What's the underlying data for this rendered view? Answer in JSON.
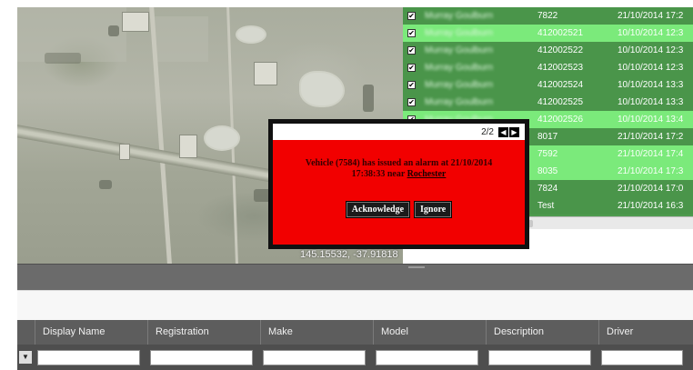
{
  "map": {
    "coordinates": "145.15532, -37.91818"
  },
  "alarm_table": {
    "rows": [
      {
        "name": "Murray Goulburn",
        "vehicle": "7822",
        "timestamp": "21/10/2014 17:2",
        "highlight": false
      },
      {
        "name": "Murray Goulburn",
        "vehicle": "412002521",
        "timestamp": "10/10/2014 12:3",
        "highlight": true
      },
      {
        "name": "Murray Goulburn",
        "vehicle": "412002522",
        "timestamp": "10/10/2014 12:3",
        "highlight": false
      },
      {
        "name": "Murray Goulburn",
        "vehicle": "412002523",
        "timestamp": "10/10/2014 12:3",
        "highlight": false
      },
      {
        "name": "Murray Goulburn",
        "vehicle": "412002524",
        "timestamp": "10/10/2014 13:3",
        "highlight": false
      },
      {
        "name": "Murray Goulburn",
        "vehicle": "412002525",
        "timestamp": "10/10/2014 13:3",
        "highlight": false
      },
      {
        "name": "Murray Goulburn",
        "vehicle": "412002526",
        "timestamp": "10/10/2014 13:4",
        "highlight": true
      },
      {
        "name": "Murray Goulburn",
        "vehicle": "8017",
        "timestamp": "21/10/2014 17:2",
        "highlight": false
      },
      {
        "name": "Murray Goulburn",
        "vehicle": "7592",
        "timestamp": "21/10/2014 17:4",
        "highlight": true
      },
      {
        "name": "Murray Goulburn",
        "vehicle": "8035",
        "timestamp": "21/10/2014 17:3",
        "highlight": true
      },
      {
        "name": "Murray Goulburn",
        "vehicle": "7824",
        "timestamp": "21/10/2014 17:0",
        "highlight": false
      },
      {
        "name": "Murray Goulburn",
        "vehicle": "Test",
        "timestamp": "21/10/2014 16:3",
        "highlight": false
      }
    ]
  },
  "dialog": {
    "pager": "2/2",
    "message_line1": "Vehicle (7584) has issued an alarm at 21/10/2014",
    "message_line2": "17:38:33 near",
    "location": "Rochester",
    "acknowledge_label": "Acknowledge",
    "ignore_label": "Ignore"
  },
  "grid": {
    "columns": [
      "Display Name",
      "Registration",
      "Make",
      "Model",
      "Description",
      "Driver"
    ]
  },
  "colors": {
    "dialog_bg": "#f20000",
    "row_dark": "#4a954a",
    "row_highlight": "#7bea7b"
  }
}
